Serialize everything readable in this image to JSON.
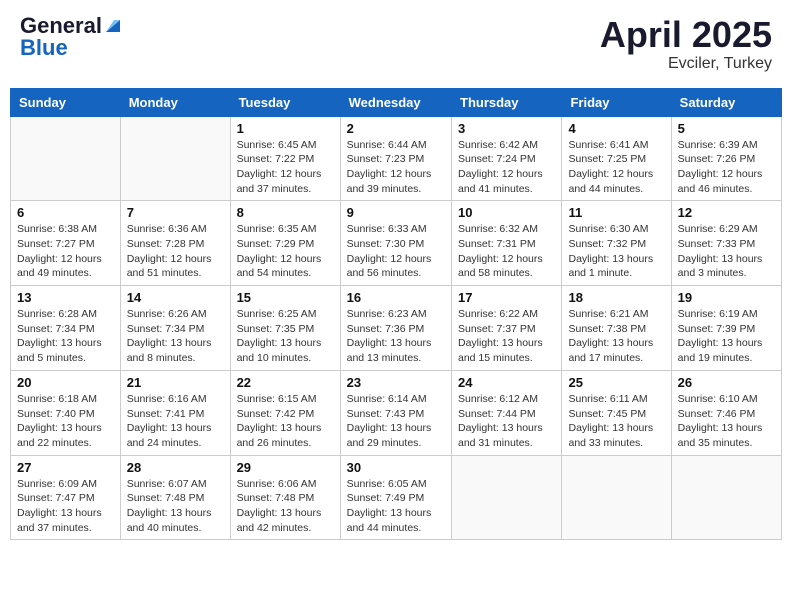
{
  "logo": {
    "general": "General",
    "blue": "Blue"
  },
  "title": {
    "month": "April 2025",
    "location": "Evciler, Turkey"
  },
  "days_of_week": [
    "Sunday",
    "Monday",
    "Tuesday",
    "Wednesday",
    "Thursday",
    "Friday",
    "Saturday"
  ],
  "weeks": [
    [
      {
        "day": "",
        "sunrise": "",
        "sunset": "",
        "daylight": ""
      },
      {
        "day": "",
        "sunrise": "",
        "sunset": "",
        "daylight": ""
      },
      {
        "day": "1",
        "sunrise": "Sunrise: 6:45 AM",
        "sunset": "Sunset: 7:22 PM",
        "daylight": "Daylight: 12 hours and 37 minutes."
      },
      {
        "day": "2",
        "sunrise": "Sunrise: 6:44 AM",
        "sunset": "Sunset: 7:23 PM",
        "daylight": "Daylight: 12 hours and 39 minutes."
      },
      {
        "day": "3",
        "sunrise": "Sunrise: 6:42 AM",
        "sunset": "Sunset: 7:24 PM",
        "daylight": "Daylight: 12 hours and 41 minutes."
      },
      {
        "day": "4",
        "sunrise": "Sunrise: 6:41 AM",
        "sunset": "Sunset: 7:25 PM",
        "daylight": "Daylight: 12 hours and 44 minutes."
      },
      {
        "day": "5",
        "sunrise": "Sunrise: 6:39 AM",
        "sunset": "Sunset: 7:26 PM",
        "daylight": "Daylight: 12 hours and 46 minutes."
      }
    ],
    [
      {
        "day": "6",
        "sunrise": "Sunrise: 6:38 AM",
        "sunset": "Sunset: 7:27 PM",
        "daylight": "Daylight: 12 hours and 49 minutes."
      },
      {
        "day": "7",
        "sunrise": "Sunrise: 6:36 AM",
        "sunset": "Sunset: 7:28 PM",
        "daylight": "Daylight: 12 hours and 51 minutes."
      },
      {
        "day": "8",
        "sunrise": "Sunrise: 6:35 AM",
        "sunset": "Sunset: 7:29 PM",
        "daylight": "Daylight: 12 hours and 54 minutes."
      },
      {
        "day": "9",
        "sunrise": "Sunrise: 6:33 AM",
        "sunset": "Sunset: 7:30 PM",
        "daylight": "Daylight: 12 hours and 56 minutes."
      },
      {
        "day": "10",
        "sunrise": "Sunrise: 6:32 AM",
        "sunset": "Sunset: 7:31 PM",
        "daylight": "Daylight: 12 hours and 58 minutes."
      },
      {
        "day": "11",
        "sunrise": "Sunrise: 6:30 AM",
        "sunset": "Sunset: 7:32 PM",
        "daylight": "Daylight: 13 hours and 1 minute."
      },
      {
        "day": "12",
        "sunrise": "Sunrise: 6:29 AM",
        "sunset": "Sunset: 7:33 PM",
        "daylight": "Daylight: 13 hours and 3 minutes."
      }
    ],
    [
      {
        "day": "13",
        "sunrise": "Sunrise: 6:28 AM",
        "sunset": "Sunset: 7:34 PM",
        "daylight": "Daylight: 13 hours and 5 minutes."
      },
      {
        "day": "14",
        "sunrise": "Sunrise: 6:26 AM",
        "sunset": "Sunset: 7:34 PM",
        "daylight": "Daylight: 13 hours and 8 minutes."
      },
      {
        "day": "15",
        "sunrise": "Sunrise: 6:25 AM",
        "sunset": "Sunset: 7:35 PM",
        "daylight": "Daylight: 13 hours and 10 minutes."
      },
      {
        "day": "16",
        "sunrise": "Sunrise: 6:23 AM",
        "sunset": "Sunset: 7:36 PM",
        "daylight": "Daylight: 13 hours and 13 minutes."
      },
      {
        "day": "17",
        "sunrise": "Sunrise: 6:22 AM",
        "sunset": "Sunset: 7:37 PM",
        "daylight": "Daylight: 13 hours and 15 minutes."
      },
      {
        "day": "18",
        "sunrise": "Sunrise: 6:21 AM",
        "sunset": "Sunset: 7:38 PM",
        "daylight": "Daylight: 13 hours and 17 minutes."
      },
      {
        "day": "19",
        "sunrise": "Sunrise: 6:19 AM",
        "sunset": "Sunset: 7:39 PM",
        "daylight": "Daylight: 13 hours and 19 minutes."
      }
    ],
    [
      {
        "day": "20",
        "sunrise": "Sunrise: 6:18 AM",
        "sunset": "Sunset: 7:40 PM",
        "daylight": "Daylight: 13 hours and 22 minutes."
      },
      {
        "day": "21",
        "sunrise": "Sunrise: 6:16 AM",
        "sunset": "Sunset: 7:41 PM",
        "daylight": "Daylight: 13 hours and 24 minutes."
      },
      {
        "day": "22",
        "sunrise": "Sunrise: 6:15 AM",
        "sunset": "Sunset: 7:42 PM",
        "daylight": "Daylight: 13 hours and 26 minutes."
      },
      {
        "day": "23",
        "sunrise": "Sunrise: 6:14 AM",
        "sunset": "Sunset: 7:43 PM",
        "daylight": "Daylight: 13 hours and 29 minutes."
      },
      {
        "day": "24",
        "sunrise": "Sunrise: 6:12 AM",
        "sunset": "Sunset: 7:44 PM",
        "daylight": "Daylight: 13 hours and 31 minutes."
      },
      {
        "day": "25",
        "sunrise": "Sunrise: 6:11 AM",
        "sunset": "Sunset: 7:45 PM",
        "daylight": "Daylight: 13 hours and 33 minutes."
      },
      {
        "day": "26",
        "sunrise": "Sunrise: 6:10 AM",
        "sunset": "Sunset: 7:46 PM",
        "daylight": "Daylight: 13 hours and 35 minutes."
      }
    ],
    [
      {
        "day": "27",
        "sunrise": "Sunrise: 6:09 AM",
        "sunset": "Sunset: 7:47 PM",
        "daylight": "Daylight: 13 hours and 37 minutes."
      },
      {
        "day": "28",
        "sunrise": "Sunrise: 6:07 AM",
        "sunset": "Sunset: 7:48 PM",
        "daylight": "Daylight: 13 hours and 40 minutes."
      },
      {
        "day": "29",
        "sunrise": "Sunrise: 6:06 AM",
        "sunset": "Sunset: 7:48 PM",
        "daylight": "Daylight: 13 hours and 42 minutes."
      },
      {
        "day": "30",
        "sunrise": "Sunrise: 6:05 AM",
        "sunset": "Sunset: 7:49 PM",
        "daylight": "Daylight: 13 hours and 44 minutes."
      },
      {
        "day": "",
        "sunrise": "",
        "sunset": "",
        "daylight": ""
      },
      {
        "day": "",
        "sunrise": "",
        "sunset": "",
        "daylight": ""
      },
      {
        "day": "",
        "sunrise": "",
        "sunset": "",
        "daylight": ""
      }
    ]
  ]
}
